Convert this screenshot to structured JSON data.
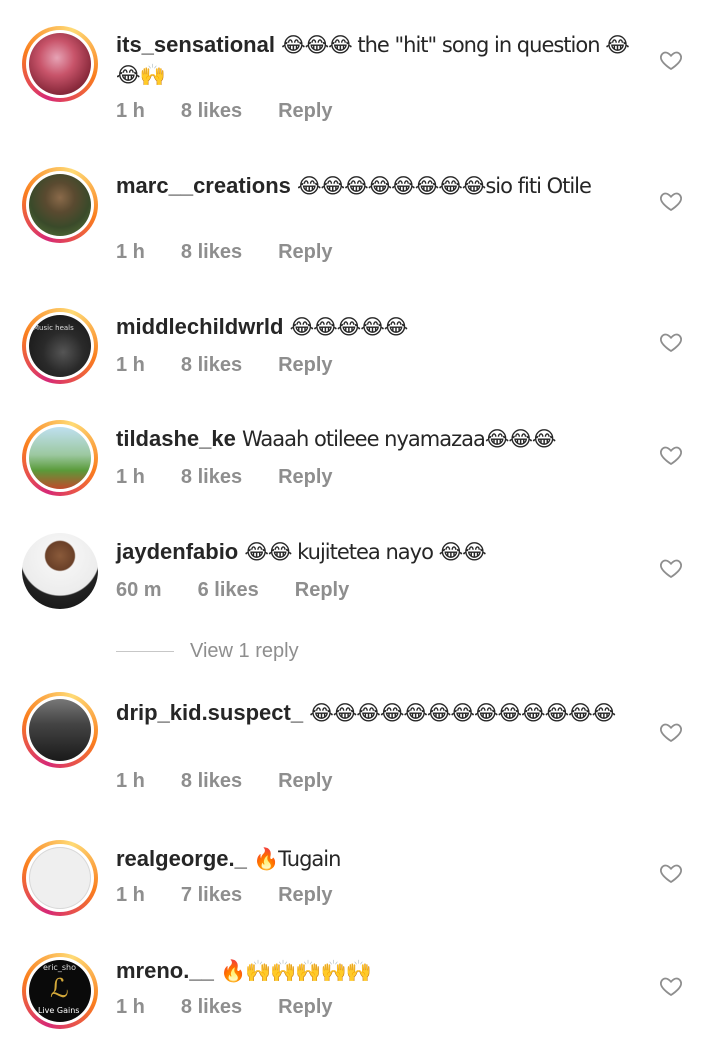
{
  "comments": [
    {
      "username": "its_sensational",
      "text": "😂😂😂 the \"hit\" song in question 😂😂🙌",
      "time": "1 h",
      "likes": "8 likes",
      "reply": "Reply"
    },
    {
      "username": "marc__creations",
      "text": "😂😂😂😂😂😂😂😂sio fiti Otile",
      "time": "1 h",
      "likes": "8 likes",
      "reply": "Reply"
    },
    {
      "username": "middlechildwrld",
      "text": "😂😂😂😂😂",
      "time": "1 h",
      "likes": "8 likes",
      "reply": "Reply",
      "avatar_caption": "Music heals"
    },
    {
      "username": "tildashe_ke",
      "text": "Waaah otileee nyamazaa😂😂😂",
      "time": "1 h",
      "likes": "8 likes",
      "reply": "Reply"
    },
    {
      "username": "jaydenfabio",
      "text": "😂😂 kujitetea nayo 😂😂",
      "time": "60 m",
      "likes": "6 likes",
      "reply": "Reply"
    },
    {
      "username": "drip_kid.suspect_",
      "text": "😂😂😂😂😂😂😂😂😂😂😂😂😂",
      "time": "1 h",
      "likes": "8 likes",
      "reply": "Reply"
    },
    {
      "username": "realgeorge._",
      "text": "🔥Tugain",
      "time": "1 h",
      "likes": "7 likes",
      "reply": "Reply"
    },
    {
      "username": "mreno.__",
      "text": "🔥🙌🙌🙌🙌🙌",
      "time": "1 h",
      "likes": "8 likes",
      "reply": "Reply",
      "avatar_caption_top": "eric_sho",
      "avatar_caption_bottom": "Live Gains"
    }
  ],
  "view_replies": "View 1 reply",
  "colors": {
    "text": "#262626",
    "meta": "#8e8e8e",
    "ring_start": "#d62976",
    "ring_end": "#feda75"
  },
  "icons": {
    "like": "heart-outline-icon"
  }
}
